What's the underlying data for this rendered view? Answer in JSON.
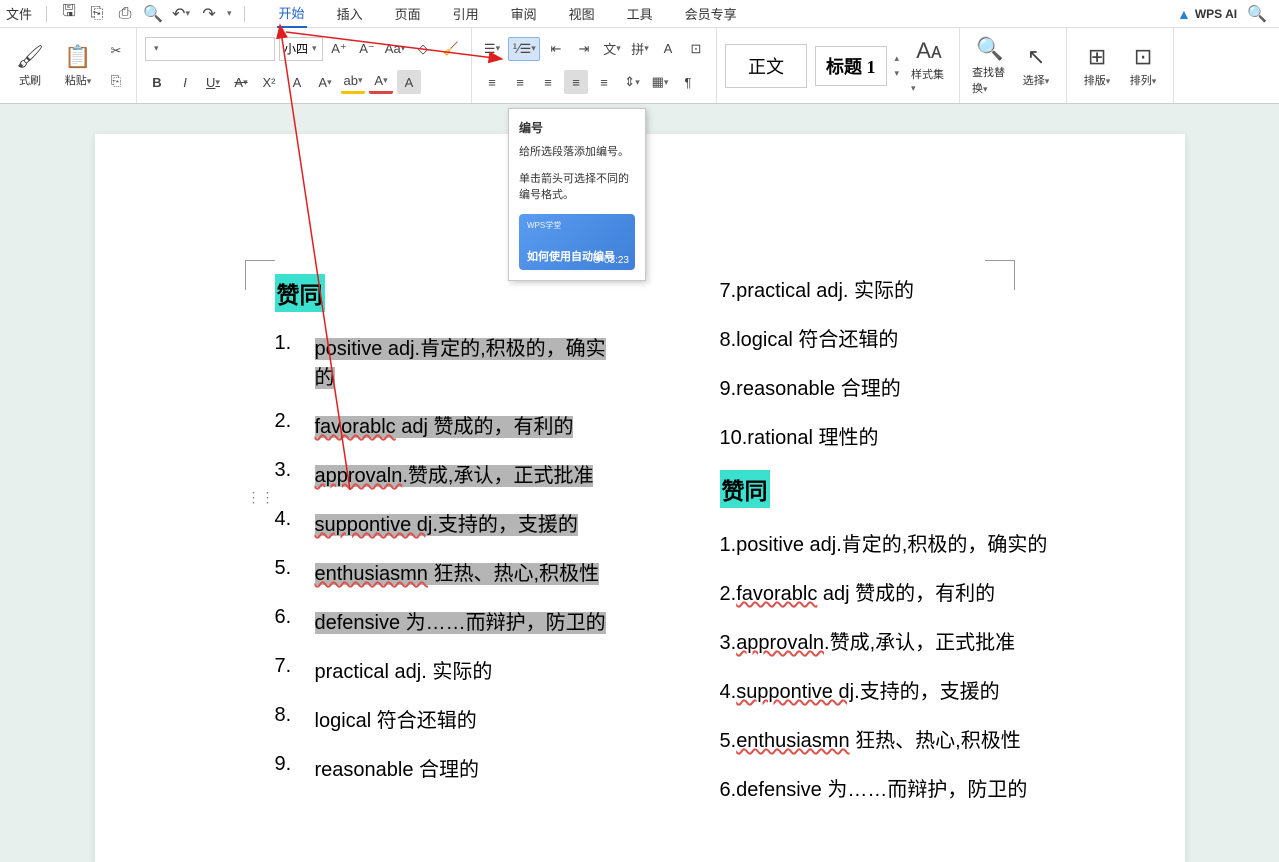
{
  "menubar": {
    "file_label": "文件",
    "tabs": [
      "开始",
      "插入",
      "页面",
      "引用",
      "审阅",
      "视图",
      "工具",
      "会员专享"
    ],
    "active_tab": "开始",
    "wps_ai": "WPS AI"
  },
  "ribbon": {
    "format_painter": "式刷",
    "paste": "粘贴",
    "font_name": "",
    "font_size": "小四",
    "bold": "B",
    "italic": "I",
    "underline": "U",
    "strike": "A",
    "superscript": "X²",
    "subscript": "A",
    "normal_style": "正文",
    "heading_style": "标题 1",
    "styles": "样式集",
    "find_replace": "查找替换",
    "select": "选择",
    "layout1": "排版",
    "layout2": "排列"
  },
  "tooltip": {
    "title": "编号",
    "desc1": "给所选段落添加编号。",
    "desc2": "单击箭头可选择不同的编号格式。",
    "video_tag": "WPS学堂",
    "video_title": "如何使用自动编号",
    "video_time": "03:23"
  },
  "document": {
    "heading": "赞同",
    "col1": [
      {
        "num": "1.",
        "text": "positive adj.肯定的,积极的，确实的",
        "sel": true,
        "multiline": true
      },
      {
        "num": "2.",
        "text": "favorablc adj 赞成的，有利的",
        "sel": true,
        "wavy": "favorablc"
      },
      {
        "num": "3.",
        "text": "approvaln.赞成,承认，正式批准",
        "sel": true,
        "wavy": "approvaln"
      },
      {
        "num": "4.",
        "text": "suppontive dj.支持的，支援的",
        "sel": true,
        "wavy": "suppontive dj"
      },
      {
        "num": "5.",
        "text": "enthusiasmn 狂热、热心,积极性",
        "sel": true,
        "wavy": "enthusiasmn"
      },
      {
        "num": "6.",
        "text": "defensive  为……而辩护，防卫的",
        "sel": true
      },
      {
        "num": "7.",
        "text": "practical adj.  实际的",
        "sel": false
      },
      {
        "num": "8.",
        "text": "logical  符合还辑的",
        "sel": false
      },
      {
        "num": "9.",
        "text": "reasonable  合理的",
        "sel": false
      }
    ],
    "col2_top": [
      {
        "num": "7.",
        "text": "practical adj.  实际的"
      },
      {
        "num": "8.",
        "text": "logical  符合还辑的"
      },
      {
        "num": "9.",
        "text": "reasonable  合理的"
      },
      {
        "num": "10.",
        "text": "rational 理性的"
      }
    ],
    "col2_heading": "赞同",
    "col2_list": [
      {
        "num": "1.",
        "text": "positive adj.肯定的,积极的，确实的"
      },
      {
        "num": "2.",
        "text": "favorablc adj 赞成的，有利的",
        "wavy": "favorablc"
      },
      {
        "num": "3.",
        "text": "approvaln.赞成,承认，正式批准",
        "wavy": "approvaln"
      },
      {
        "num": "4.",
        "text": "suppontive dj.支持的，支援的",
        "wavy": "suppontive dj"
      },
      {
        "num": "5.",
        "text": "enthusiasmn 狂热、热心,积极性",
        "wavy": "enthusiasmn"
      },
      {
        "num": "6.",
        "text": "defensive  为……而辩护，防卫的"
      }
    ]
  }
}
